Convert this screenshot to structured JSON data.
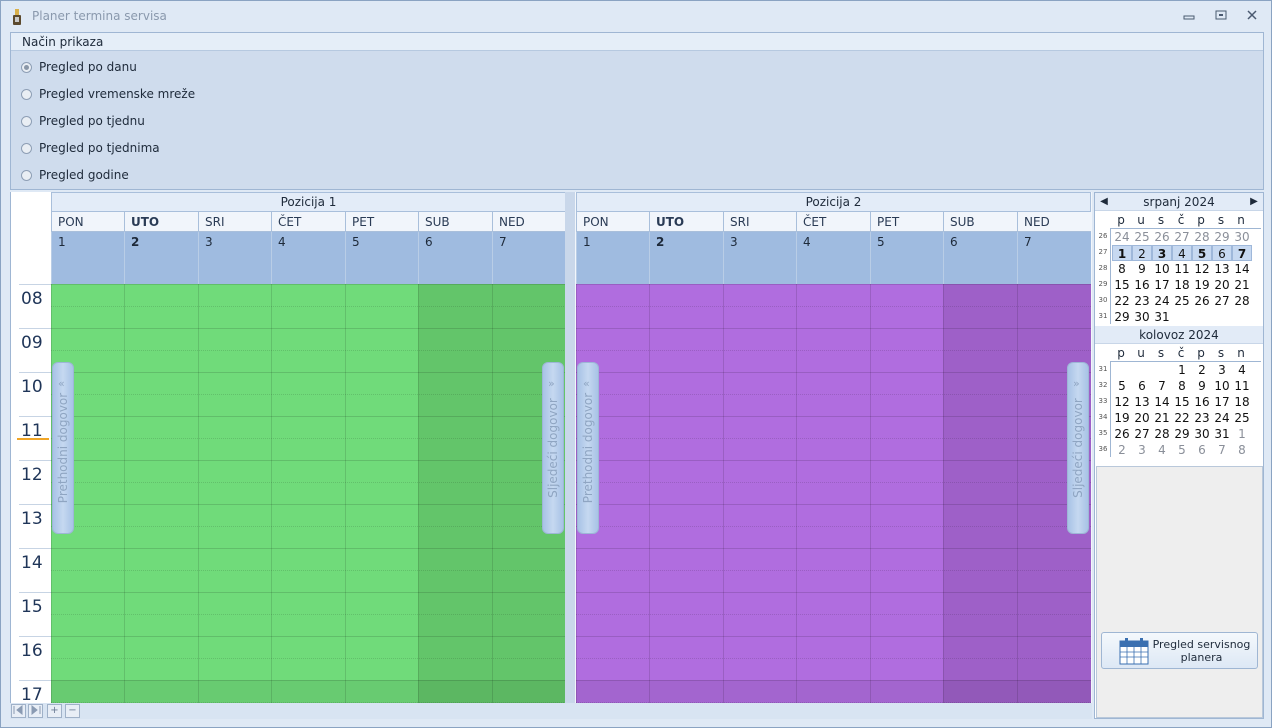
{
  "window": {
    "title": "Planer termina servisa",
    "minimize": "▭",
    "maximize": "▢",
    "close": "✕"
  },
  "view_mode": {
    "header": "Način prikaza",
    "selected": "Pregled po danu",
    "options": [
      "Pregled po danu",
      "Pregled vremenske mreže",
      "Pregled po tjednu",
      "Pregled po tjednima",
      "Pregled godine"
    ]
  },
  "scheduler": {
    "hours": [
      "08",
      "09",
      "10",
      "11",
      "12",
      "13",
      "14",
      "15",
      "16",
      "17"
    ],
    "resources": [
      {
        "name": "Pozicija 1",
        "color": "#70db7a",
        "weekend_color": "#63c56a",
        "prev_label": "Prethodni dogovor",
        "next_label": "Sljedeći dogovor",
        "days": [
          {
            "name": "PON",
            "date": "1",
            "bold": false
          },
          {
            "name": "UTO",
            "date": "2",
            "bold": true
          },
          {
            "name": "SRI",
            "date": "3",
            "bold": false
          },
          {
            "name": "ČET",
            "date": "4",
            "bold": false
          },
          {
            "name": "PET",
            "date": "5",
            "bold": false
          },
          {
            "name": "SUB",
            "date": "6",
            "bold": false
          },
          {
            "name": "NED",
            "date": "7",
            "bold": false
          }
        ]
      },
      {
        "name": "Pozicija 2",
        "color": "#b06ddf",
        "weekend_color": "#9e60c8",
        "prev_label": "Prethodni dogovor",
        "next_label": "Sljedeći dogovor",
        "days": [
          {
            "name": "PON",
            "date": "1",
            "bold": false
          },
          {
            "name": "UTO",
            "date": "2",
            "bold": true
          },
          {
            "name": "SRI",
            "date": "3",
            "bold": false
          },
          {
            "name": "ČET",
            "date": "4",
            "bold": false
          },
          {
            "name": "PET",
            "date": "5",
            "bold": false
          },
          {
            "name": "SUB",
            "date": "6",
            "bold": false
          },
          {
            "name": "NED",
            "date": "7",
            "bold": false
          }
        ]
      }
    ],
    "navigator": {
      "first": "⏮",
      "prev": "⏭",
      "add": "+",
      "remove": "−"
    }
  },
  "date_navigator": {
    "weekday_headers": [
      "p",
      "u",
      "s",
      "č",
      "p",
      "s",
      "n"
    ],
    "months": [
      {
        "title": "srpanj 2024",
        "weeks": [
          {
            "num": "26",
            "days": [
              "24",
              "25",
              "26",
              "27",
              "28",
              "29",
              "30"
            ],
            "other": [
              true,
              true,
              true,
              true,
              true,
              true,
              true
            ]
          },
          {
            "num": "27",
            "days": [
              "1",
              "2",
              "3",
              "4",
              "5",
              "6",
              "7"
            ],
            "other": [
              false,
              false,
              false,
              false,
              false,
              false,
              false
            ],
            "selected": true
          },
          {
            "num": "28",
            "days": [
              "8",
              "9",
              "10",
              "11",
              "12",
              "13",
              "14"
            ],
            "other": [
              false,
              false,
              false,
              false,
              false,
              false,
              false
            ]
          },
          {
            "num": "29",
            "days": [
              "15",
              "16",
              "17",
              "18",
              "19",
              "20",
              "21"
            ],
            "other": [
              false,
              false,
              false,
              false,
              false,
              false,
              false
            ]
          },
          {
            "num": "30",
            "days": [
              "22",
              "23",
              "24",
              "25",
              "26",
              "27",
              "28"
            ],
            "other": [
              false,
              false,
              false,
              false,
              false,
              false,
              false
            ]
          },
          {
            "num": "31",
            "days": [
              "29",
              "30",
              "31",
              "",
              "",
              "",
              ""
            ],
            "other": [
              false,
              false,
              false,
              false,
              false,
              false,
              false
            ]
          }
        ]
      },
      {
        "title": "kolovoz 2024",
        "weeks": [
          {
            "num": "31",
            "days": [
              "",
              "",
              "",
              "1",
              "2",
              "3",
              "4"
            ],
            "other": [
              false,
              false,
              false,
              false,
              false,
              false,
              false
            ]
          },
          {
            "num": "32",
            "days": [
              "5",
              "6",
              "7",
              "8",
              "9",
              "10",
              "11"
            ],
            "other": [
              false,
              false,
              false,
              false,
              false,
              false,
              false
            ]
          },
          {
            "num": "33",
            "days": [
              "12",
              "13",
              "14",
              "15",
              "16",
              "17",
              "18"
            ],
            "other": [
              false,
              false,
              false,
              false,
              false,
              false,
              false
            ]
          },
          {
            "num": "34",
            "days": [
              "19",
              "20",
              "21",
              "22",
              "23",
              "24",
              "25"
            ],
            "other": [
              false,
              false,
              false,
              false,
              false,
              false,
              false
            ]
          },
          {
            "num": "35",
            "days": [
              "26",
              "27",
              "28",
              "29",
              "30",
              "31",
              "1"
            ],
            "other": [
              false,
              false,
              false,
              false,
              false,
              false,
              true
            ]
          },
          {
            "num": "36",
            "days": [
              "2",
              "3",
              "4",
              "5",
              "6",
              "7",
              "8"
            ],
            "other": [
              true,
              true,
              true,
              true,
              true,
              true,
              true
            ]
          }
        ]
      }
    ],
    "prev_arrow": "◀",
    "next_arrow": "▶"
  },
  "planner_button": {
    "label": "Pregled servisnog planera",
    "icon": "calendar-icon"
  }
}
